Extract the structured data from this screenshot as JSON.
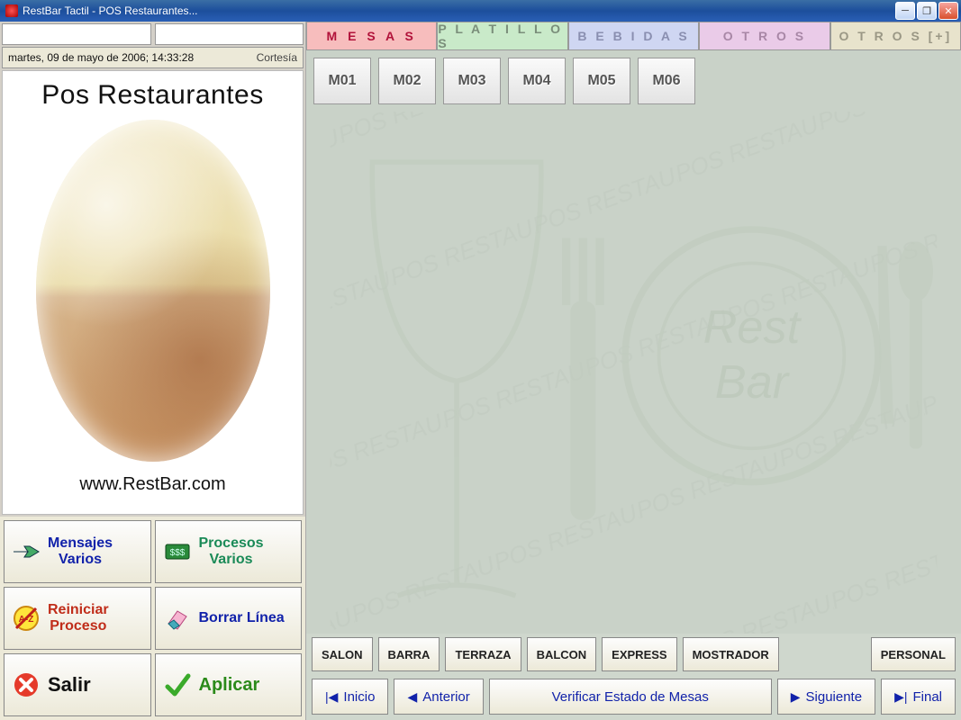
{
  "window": {
    "title": "RestBar Tactil - POS Restaurantes..."
  },
  "left": {
    "datetime": "martes, 09 de mayo de 2006; 14:33:28",
    "cortesia": "Cortesía",
    "promo_title": "Pos Restaurantes",
    "promo_url": "www.RestBar.com",
    "actions": {
      "mensajes": "Mensajes\nVarios",
      "procesos": "Procesos\nVarios",
      "reiniciar": "Reiniciar\nProceso",
      "borrar": "Borrar Línea",
      "salir": "Salir",
      "aplicar": "Aplicar"
    }
  },
  "tabs": {
    "mesas": "M E S A S",
    "platillos": "P L A T I L L O S",
    "bebidas": "B E B I D A S",
    "otros": "O T R O S",
    "otrosplus": "O T R O S [+]"
  },
  "tables": [
    "M01",
    "M02",
    "M03",
    "M04",
    "M05",
    "M06"
  ],
  "watermark": {
    "line1": "Rest",
    "line2": "Bar"
  },
  "locations": [
    "SALON",
    "BARRA",
    "TERRAZA",
    "BALCON",
    "EXPRESS",
    "MOSTRADOR"
  ],
  "personal": "PERSONAL",
  "nav": {
    "inicio": "Inicio",
    "anterior": "Anterior",
    "verificar": "Verificar Estado de Mesas",
    "siguiente": "Siguiente",
    "final": "Final"
  }
}
